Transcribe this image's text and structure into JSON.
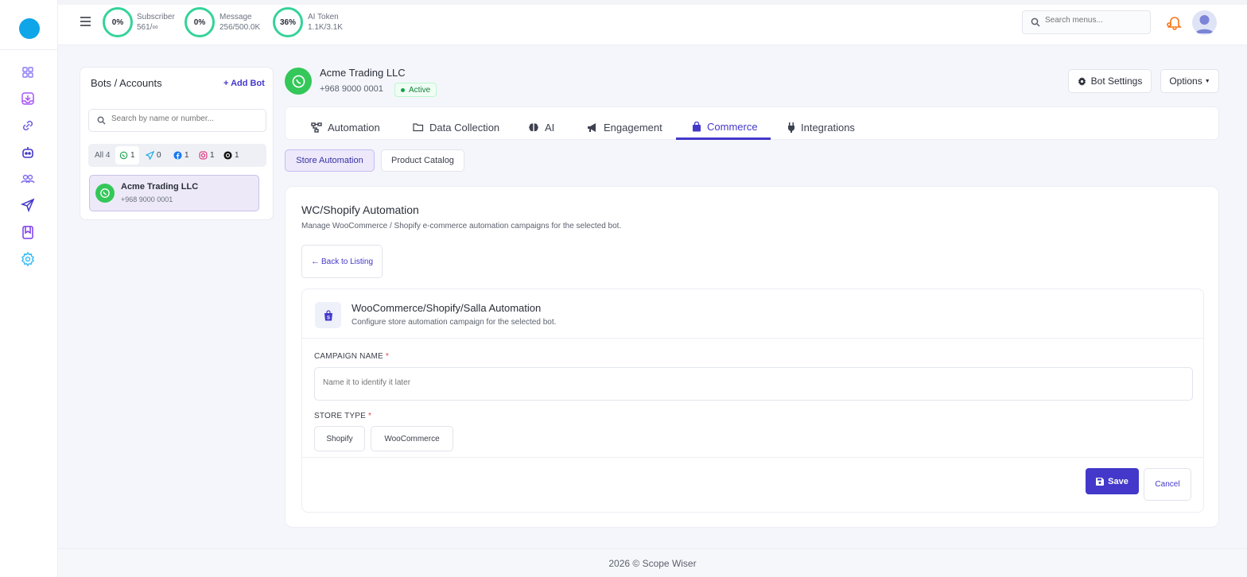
{
  "header": {
    "stats": [
      {
        "percent": "0%",
        "label": "Subscriber",
        "value": "561/∞"
      },
      {
        "percent": "0%",
        "label": "Message",
        "value": "256/500.0K"
      },
      {
        "percent": "36%",
        "label": "AI Token",
        "value": "1.1K/3.1K"
      }
    ],
    "search_placeholder": "Search menus..."
  },
  "sidebar": {
    "icons": [
      "dashboard-icon",
      "inbox-icon",
      "link-icon",
      "bot-icon",
      "users-icon",
      "send-icon",
      "bookmark-icon",
      "settings-icon"
    ]
  },
  "bots_panel": {
    "title": "Bots / Accounts",
    "add_label": "+ Add Bot",
    "search_placeholder": "Search by name or number...",
    "filters": {
      "all": "All 4",
      "whatsapp": "1",
      "telegram": "0",
      "facebook": "1",
      "instagram": "1",
      "threads": "1"
    },
    "bot": {
      "name": "Acme Trading LLC",
      "number": "+968 9000 0001"
    }
  },
  "bot_header": {
    "name": "Acme Trading LLC",
    "number": "+968 9000 0001",
    "status": "Active",
    "settings_label": "Bot Settings",
    "options_label": "Options"
  },
  "tabs": [
    {
      "label": "Automation"
    },
    {
      "label": "Data Collection"
    },
    {
      "label": "AI"
    },
    {
      "label": "Engagement"
    },
    {
      "label": "Commerce"
    },
    {
      "label": "Integrations"
    }
  ],
  "subtabs": {
    "store": "Store Automation",
    "catalog": "Product Catalog"
  },
  "section": {
    "title": "WC/Shopify Automation",
    "subtitle": "Manage WooCommerce / Shopify e-commerce automation campaigns for the selected bot.",
    "back_label": "Back to Listing"
  },
  "form": {
    "title": "WooCommerce/Shopify/Salla Automation",
    "subtitle": "Configure store automation campaign for the selected bot.",
    "campaign_label": "CAMPAIGN NAME",
    "campaign_placeholder": "Name it to identify it later",
    "store_label": "STORE TYPE",
    "store_options": [
      "Shopify",
      "WooCommerce"
    ],
    "required_mark": "*",
    "save_label": "Save",
    "cancel_label": "Cancel"
  },
  "footer": {
    "text": "2026 © Scope Wiser"
  },
  "colors": {
    "accent": "#4338ca",
    "success": "#34d399",
    "whatsapp": "#34c759"
  }
}
